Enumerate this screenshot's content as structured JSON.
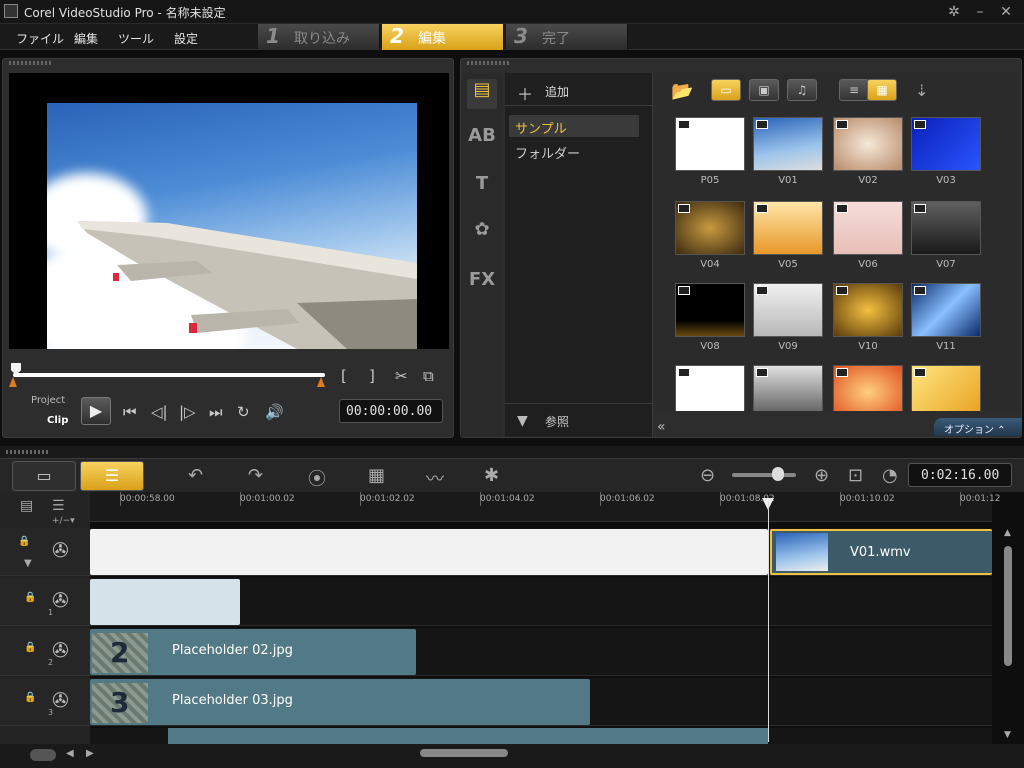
{
  "titlebar": {
    "title": "Corel VideoStudio Pro - 名称未設定"
  },
  "menu": [
    "ファイル",
    "編集",
    "ツール",
    "設定"
  ],
  "steps": [
    {
      "num": "1",
      "label": "取り込み"
    },
    {
      "num": "2",
      "label": "編集"
    },
    {
      "num": "3",
      "label": "完了"
    }
  ],
  "preview": {
    "mode_project": "Project",
    "mode_clip": "Clip",
    "timecode": "00:00:00.00",
    "mark_in": "[",
    "mark_out": "]"
  },
  "library": {
    "add_label": "追加",
    "folders": [
      "サンプル",
      "フォルダー"
    ],
    "browse_label": "参照",
    "fx_label": "FX",
    "option_label": "オプション",
    "thumbs": [
      "P05",
      "V01",
      "V02",
      "V03",
      "V04",
      "V05",
      "V06",
      "V07",
      "V08",
      "V09",
      "V10",
      "V11"
    ]
  },
  "timeline": {
    "duration": "0:02:16.00",
    "ruler": [
      "00:00:58.00",
      "00:01:00.02",
      "00:01:02.02",
      "00:01:04.02",
      "00:01:06.02",
      "00:01:08.02",
      "00:01:10.02",
      "00:01:12"
    ],
    "video_clip": "V01.wmv",
    "overlay_clips": [
      {
        "number": "2",
        "name": "Placeholder 02.jpg"
      },
      {
        "number": "3",
        "name": "Placeholder 03.jpg"
      }
    ],
    "track_numbers": [
      "1",
      "2",
      "3"
    ]
  }
}
